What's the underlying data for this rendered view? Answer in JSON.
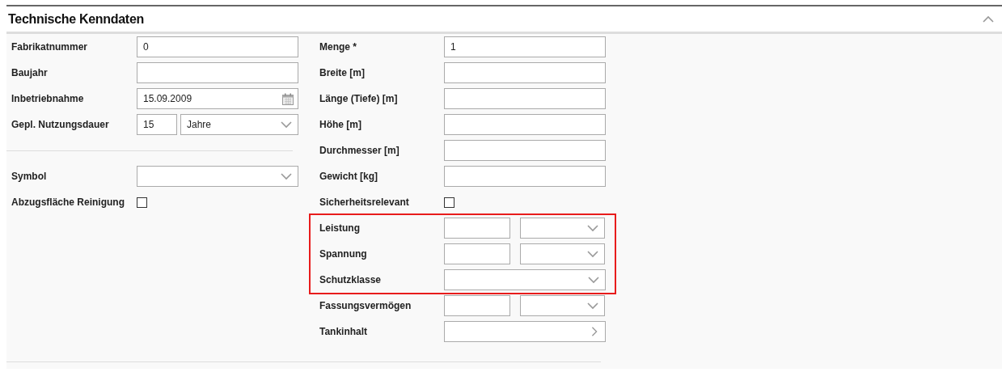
{
  "section": {
    "title": "Technische Kenndaten",
    "expanded": true
  },
  "left_fields": [
    {
      "kind": "text",
      "label": "Fabrikatnummer",
      "value": "0"
    },
    {
      "kind": "text",
      "label": "Baujahr"
    },
    {
      "kind": "date",
      "label": "Inbetriebnahme",
      "value": "15.09.2009"
    },
    {
      "kind": "number_unit",
      "label": "Gepl. Nutzungsdauer",
      "value": "15",
      "unit": "Jahre"
    },
    {
      "kind": "divider"
    },
    {
      "kind": "select",
      "label": "Symbol"
    },
    {
      "kind": "checkbox",
      "label": "Abzugsfläche Reinigung",
      "checked": false
    }
  ],
  "right_fields": [
    {
      "kind": "text",
      "label": "Menge *",
      "value": "1",
      "highlighted": false
    },
    {
      "kind": "text",
      "label": "Breite [m]",
      "highlighted": false
    },
    {
      "kind": "text",
      "label": "Länge (Tiefe) [m]",
      "highlighted": false
    },
    {
      "kind": "text",
      "label": "Höhe [m]",
      "highlighted": false
    },
    {
      "kind": "text",
      "label": "Durchmesser [m]",
      "highlighted": false
    },
    {
      "kind": "text",
      "label": "Gewicht [kg]",
      "highlighted": false
    },
    {
      "kind": "checkbox",
      "label": "Sicherheitsrelevant",
      "checked": false,
      "highlighted": false
    },
    {
      "kind": "value_unit",
      "label": "Leistung",
      "highlighted": true
    },
    {
      "kind": "value_unit",
      "label": "Spannung",
      "highlighted": true
    },
    {
      "kind": "select",
      "label": "Schutzklasse",
      "highlighted": true
    },
    {
      "kind": "value_unit",
      "label": "Fassungsvermögen",
      "highlighted": false
    },
    {
      "kind": "picker",
      "label": "Tankinhalt",
      "highlighted": false
    }
  ]
}
